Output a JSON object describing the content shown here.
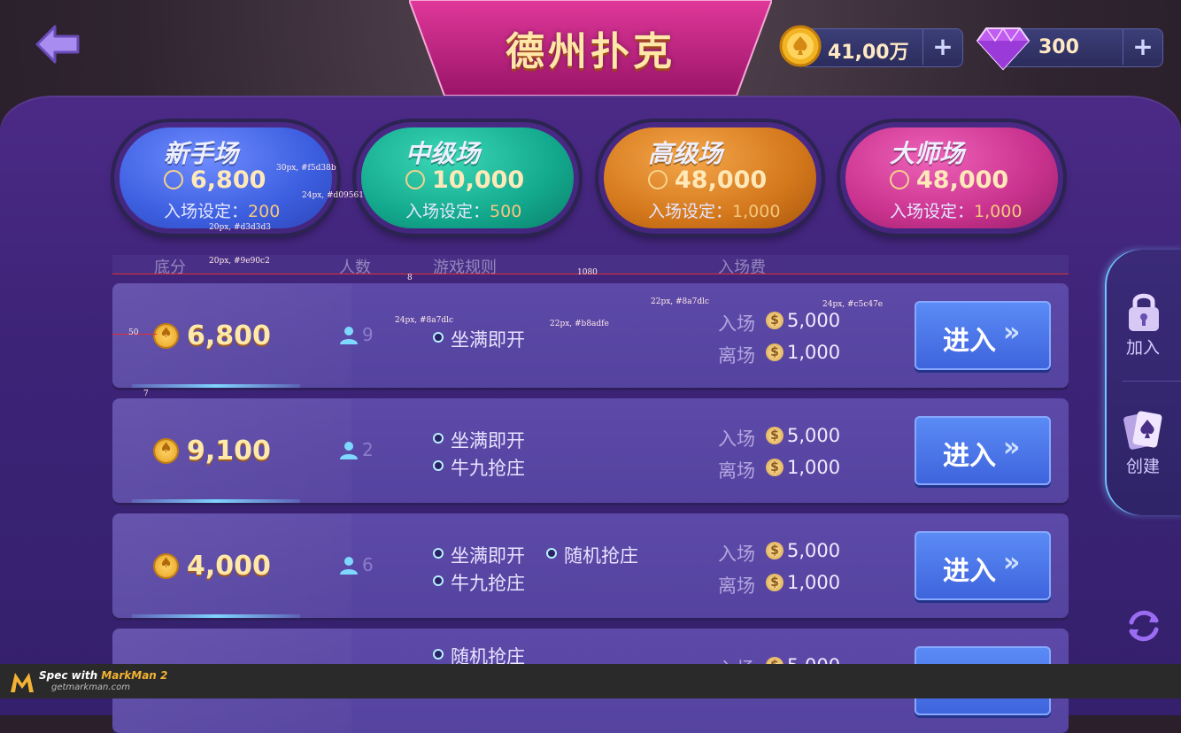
{
  "header": {
    "title": "德州扑克",
    "coins": "41,00万",
    "gems": "300",
    "plus": "+"
  },
  "levels": [
    {
      "name": "新手场",
      "amount": "6,800",
      "setting_label": "入场设定：",
      "setting_value": "200",
      "color": "#3c5fe0"
    },
    {
      "name": "中级场",
      "amount": "10,000",
      "setting_label": "入场设定：",
      "setting_value": "500",
      "color": "#13a98e"
    },
    {
      "name": "高级场",
      "amount": "48,000",
      "setting_label": "入场设定：",
      "setting_value": "1,000",
      "color": "#d4781c"
    },
    {
      "name": "大师场",
      "amount": "48,000",
      "setting_label": "入场设定：",
      "setting_value": "1,000",
      "color": "#c9328e"
    }
  ],
  "table": {
    "columns": [
      "底分",
      "人数",
      "游戏规则",
      "入场费"
    ],
    "rows": [
      {
        "base": "6,800",
        "players": "9",
        "rules": [
          "坐满即开"
        ],
        "enter_fee": "5,000",
        "leave_fee": "1,000"
      },
      {
        "base": "9,100",
        "players": "2",
        "rules": [
          "坐满即开",
          "牛九抢庄"
        ],
        "enter_fee": "5,000",
        "leave_fee": "1,000"
      },
      {
        "base": "4,000",
        "players": "6",
        "rules": [
          "坐满即开",
          "随机抢庄",
          "牛九抢庄"
        ],
        "enter_fee": "5,000",
        "leave_fee": "1,000"
      },
      {
        "base": "",
        "players": "",
        "rules": [
          "随机抢庄"
        ],
        "enter_fee": "5,000",
        "leave_fee": ""
      }
    ],
    "enter_label": "入场",
    "leave_label": "离场",
    "enter_button": "进入"
  },
  "side": {
    "join": "加入",
    "create": "创建"
  },
  "annotations": {
    "a1": "30px, #f5d38b",
    "a2": "24px, #d09561",
    "a3": "20px, #d3d3d3",
    "a4": "20px, #9e90c2",
    "a5": "8",
    "a6": "1080",
    "a7": "24px, #8a7dlc",
    "a8": "22px, #b8adfe",
    "a9": "22px, #8a7dlc",
    "a10": "24px, #c5c47e",
    "a11": "50",
    "a12": "7"
  },
  "footer": {
    "line1_prefix": "Spec with ",
    "line1_brand": "MarkMan 2",
    "line2": "getmarkman.com"
  }
}
